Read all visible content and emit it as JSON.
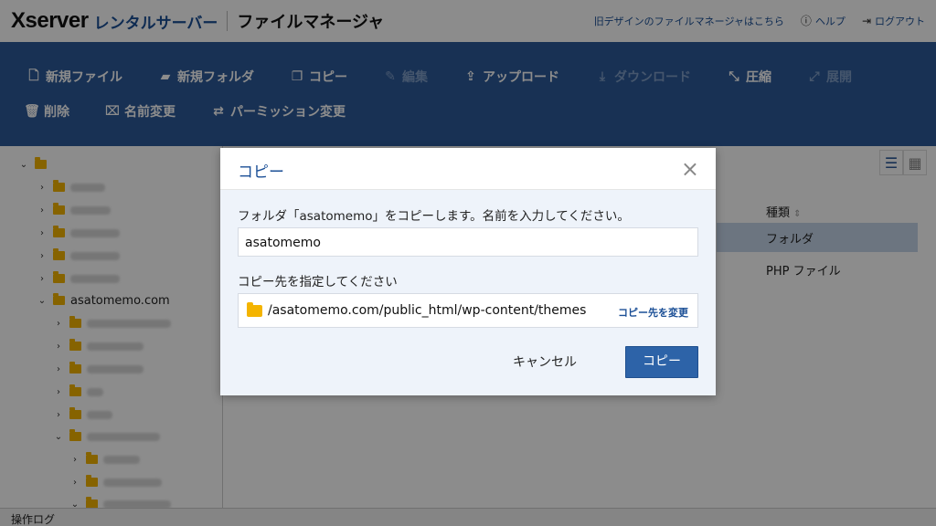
{
  "header": {
    "logo_brand": "Xserver",
    "logo_product": "レンタルサーバー",
    "app_title": "ファイルマネージャ",
    "links": {
      "old_design": "旧デザインのファイルマネージャはこちら",
      "help": "ヘルプ",
      "logout": "ログアウト"
    }
  },
  "toolbar": {
    "row1": [
      {
        "label": "新規ファイル",
        "icon": "new-file-icon",
        "disabled": false
      },
      {
        "label": "新規フォルダ",
        "icon": "new-folder-icon",
        "disabled": false
      },
      {
        "label": "コピー",
        "icon": "copy-icon",
        "disabled": false
      },
      {
        "label": "編集",
        "icon": "edit-icon",
        "disabled": true
      },
      {
        "label": "アップロード",
        "icon": "upload-icon",
        "disabled": false
      },
      {
        "label": "ダウンロード",
        "icon": "download-icon",
        "disabled": true
      },
      {
        "label": "圧縮",
        "icon": "compress-icon",
        "disabled": false
      },
      {
        "label": "展開",
        "icon": "extract-icon",
        "disabled": true
      }
    ],
    "row2": [
      {
        "label": "削除",
        "icon": "trash-icon",
        "disabled": false
      },
      {
        "label": "名前変更",
        "icon": "rename-icon",
        "disabled": false
      },
      {
        "label": "パーミッション変更",
        "icon": "permission-icon",
        "disabled": false
      }
    ]
  },
  "tree": {
    "domain_label": "asatomemo.com"
  },
  "file_list": {
    "type_header": "種類",
    "types": [
      "フォルダ",
      "PHP ファイル"
    ]
  },
  "bottom_bar": {
    "label": "操作ログ"
  },
  "dialog": {
    "title": "コピー",
    "close_glyph": "×",
    "message": "フォルダ「asatomemo」をコピーします。名前を入力してください。",
    "name_value": "asatomemo",
    "dest_label": "コピー先を指定してください",
    "dest_path": "/asatomemo.com/public_html/wp-content/themes",
    "change_dest": "コピー先を変更",
    "cancel": "キャンセル",
    "confirm": "コピー"
  },
  "colors": {
    "toolbar_bg": "#2d5a99",
    "accent": "#1b4f96",
    "primary_button": "#2d63a8",
    "folder": "#f4b400"
  }
}
